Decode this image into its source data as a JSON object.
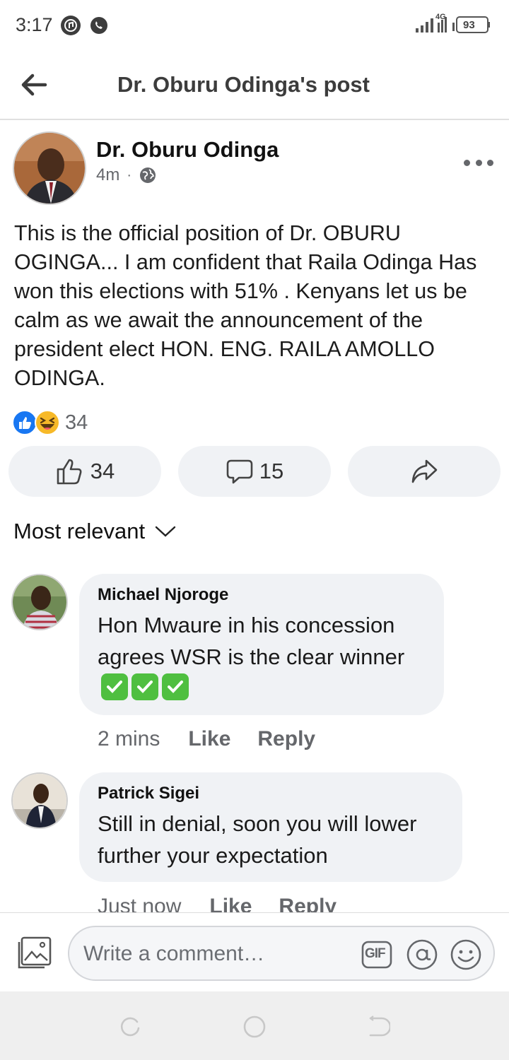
{
  "status_bar": {
    "time": "3:17",
    "network": "4G",
    "battery": "93",
    "icons": [
      "music-notification-icon",
      "whatsapp-notification-icon",
      "signal-icon",
      "battery-icon"
    ]
  },
  "header": {
    "title": "Dr. Oburu Odinga's post",
    "back_icon": "arrow-left-icon"
  },
  "post": {
    "author": "Dr. Oburu Odinga",
    "time": "4m",
    "separator": "·",
    "privacy_icon": "globe-icon",
    "text": "This is the official position of Dr. OBURU OGINGA... I am confident that Raila Odinga Has won this elections with 51% . Kenyans let us be calm as we await the announcement of the president elect HON. ENG. RAILA AMOLLO ODINGA.",
    "reaction_count": "34",
    "reaction_icons": [
      "like-reaction-icon",
      "haha-reaction-icon"
    ],
    "like_count": "34",
    "comment_count": "15"
  },
  "comments_filter": {
    "label": "Most relevant"
  },
  "comments": [
    {
      "name": "Michael Njoroge",
      "text": "Hon Mwaure in his concession agrees WSR is the clear winner",
      "emoji": "check-mark-button-icon",
      "time": "2 mins",
      "like_label": "Like",
      "reply_label": "Reply"
    },
    {
      "name": "Patrick Sigei",
      "text": "Still in denial, soon you will lower further your expectation",
      "time": "Just now",
      "like_label": "Like",
      "reply_label": "Reply"
    }
  ],
  "composer": {
    "placeholder": "Write a comment…",
    "gif_label": "GIF"
  },
  "colors": {
    "accent_blue": "#1877f2",
    "bubble_bg": "#f0f2f5",
    "muted_text": "#65676b",
    "check_green": "#4fbf40"
  }
}
